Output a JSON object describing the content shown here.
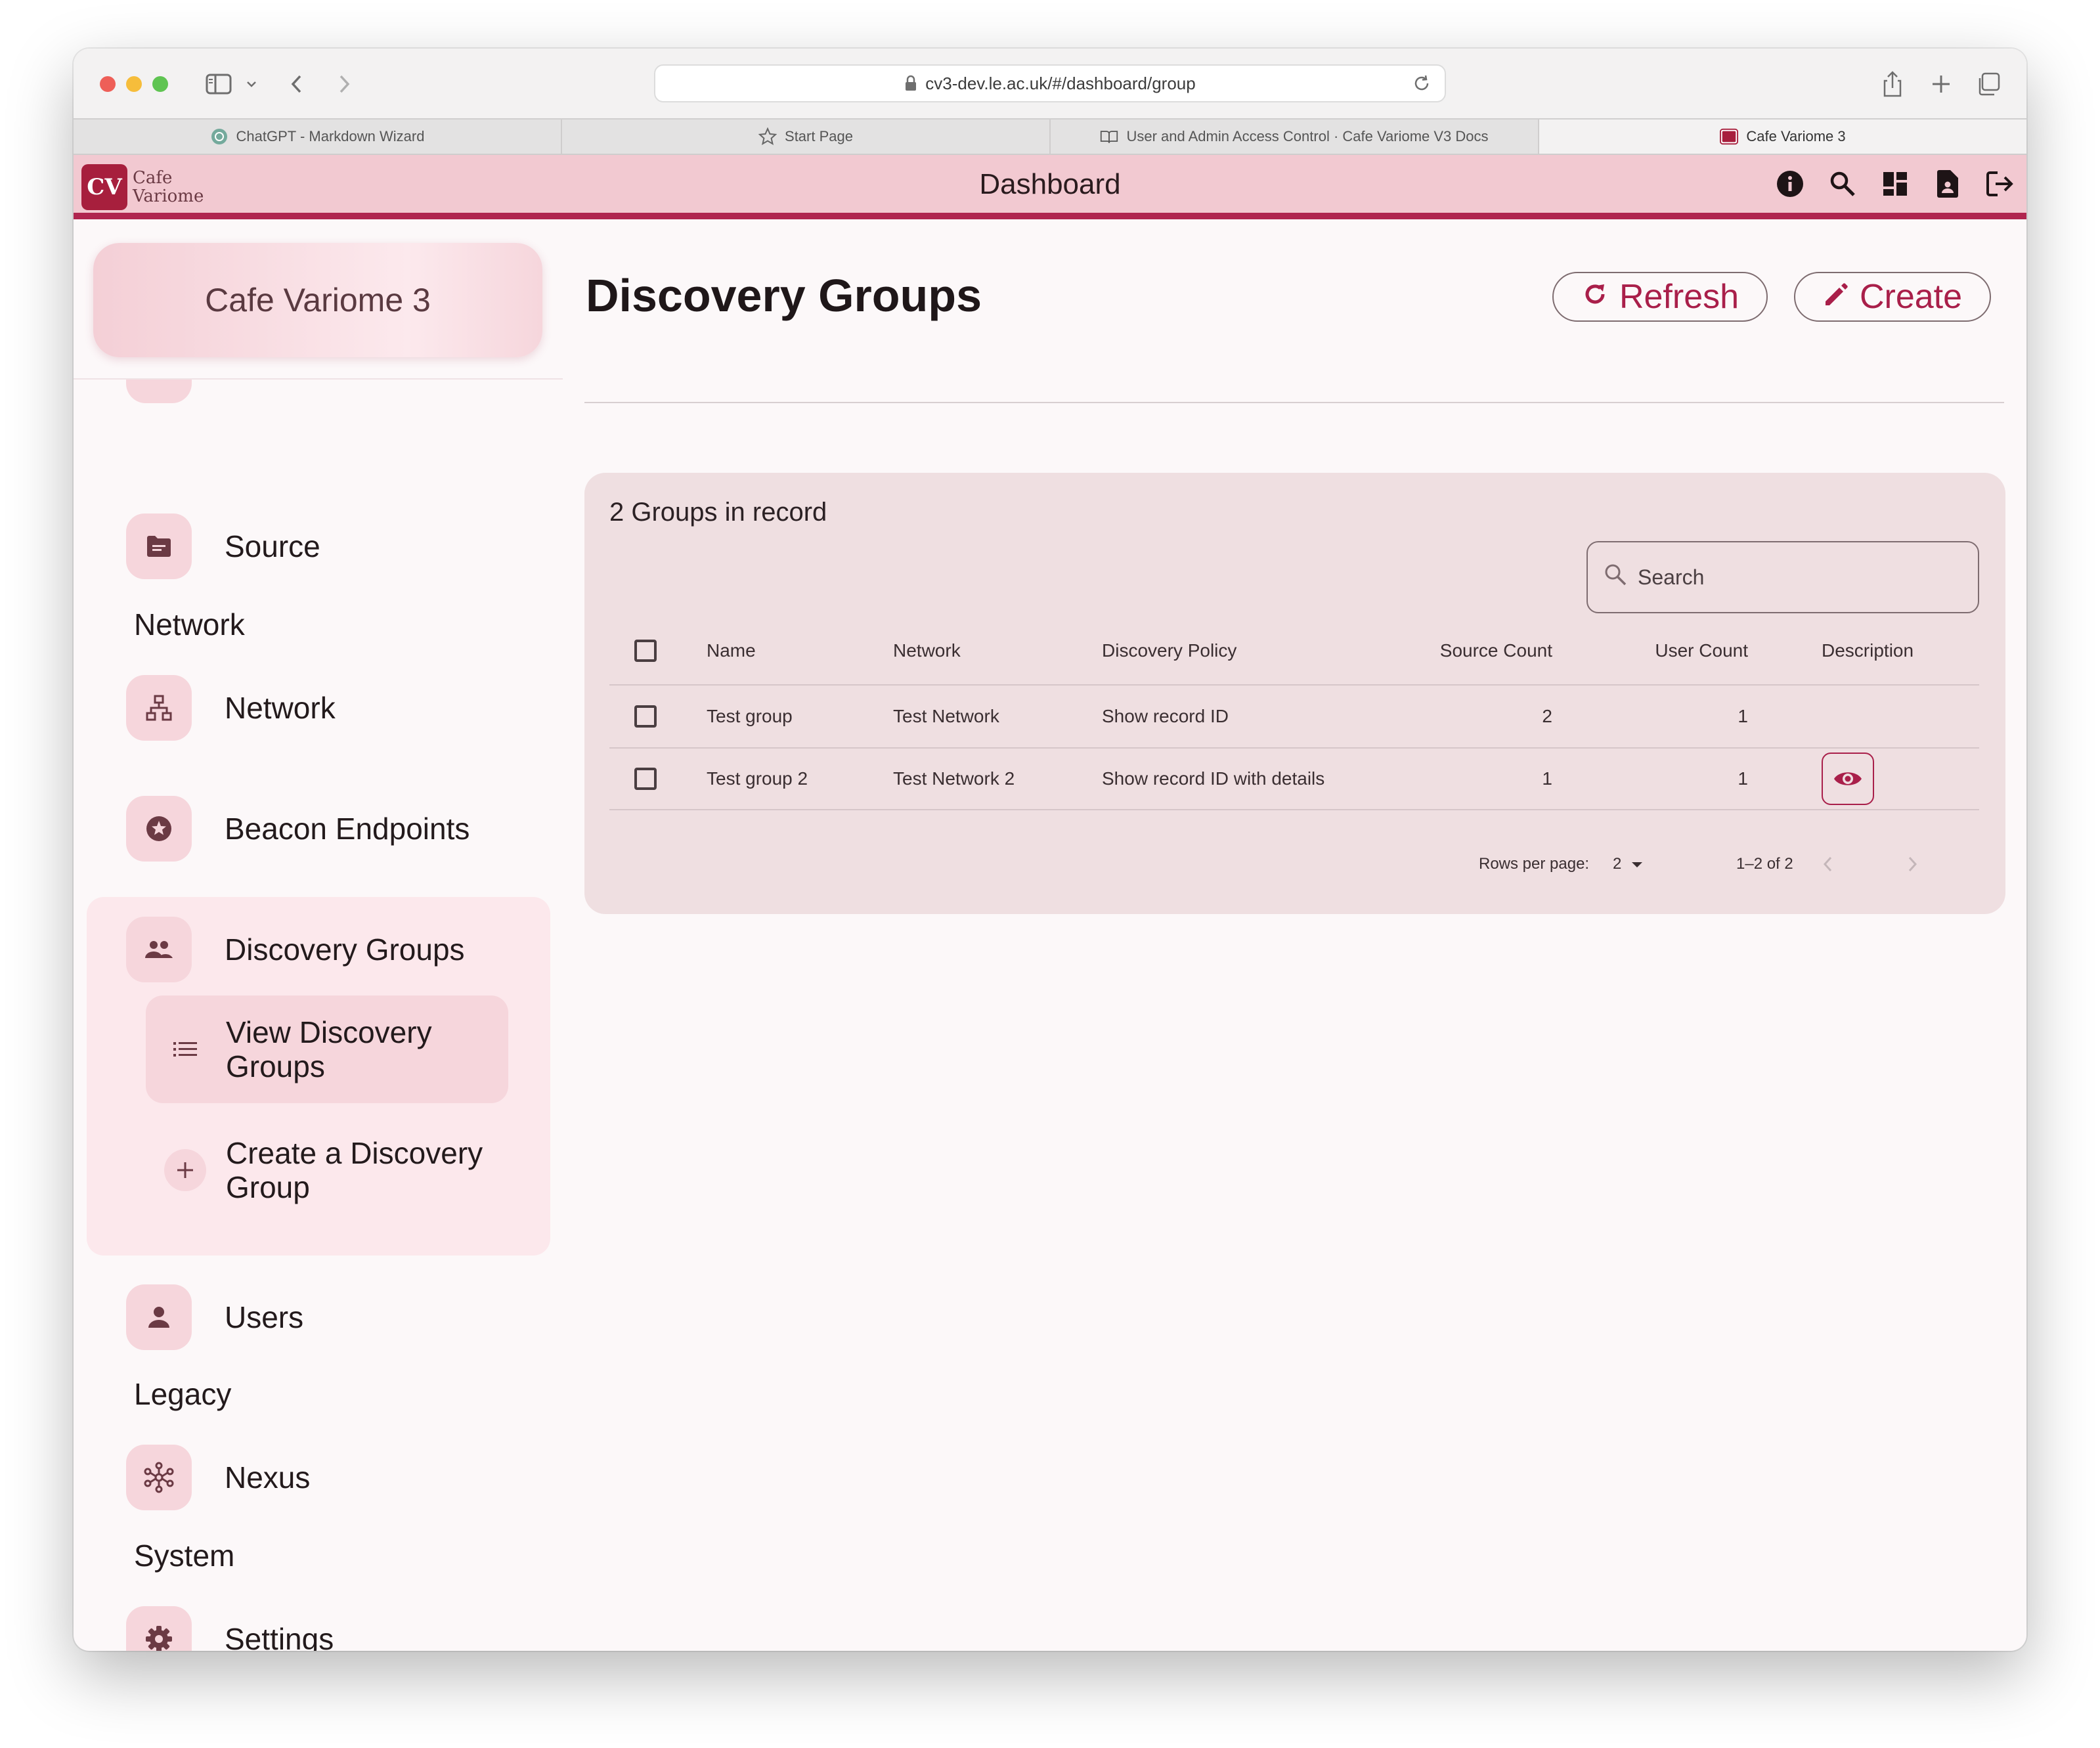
{
  "browser": {
    "url": "cv3-dev.le.ac.uk/#/dashboard/group",
    "tabs": [
      {
        "label": "ChatGPT - Markdown Wizard",
        "icon": "chatgpt-icon"
      },
      {
        "label": "Start Page",
        "icon": "star-icon"
      },
      {
        "label": "User and Admin Access Control · Cafe Variome V3 Docs",
        "icon": "book-icon"
      },
      {
        "label": "Cafe Variome 3",
        "icon": "cv-favicon",
        "active": true
      }
    ]
  },
  "appbar": {
    "logo_letters": "CV",
    "logo_line1": "Cafe",
    "logo_line2": "Variome",
    "title": "Dashboard",
    "actions": [
      "info-icon",
      "search-icon",
      "dashboard-icon",
      "document-icon",
      "logout-icon"
    ]
  },
  "sidebar": {
    "brand": "Cafe Variome 3",
    "items": {
      "source": "Source",
      "network_section": "Network",
      "network": "Network",
      "beacon": "Beacon Endpoints",
      "discovery_groups": "Discovery Groups",
      "view_groups": "View Discovery Groups",
      "create_group": "Create a Discovery Group",
      "users": "Users",
      "legacy_section": "Legacy",
      "nexus": "Nexus",
      "system_section": "System",
      "settings": "Settings"
    }
  },
  "main": {
    "title": "Discovery Groups",
    "refresh_label": "Refresh",
    "create_label": "Create",
    "record_count": "2 Groups in record",
    "search_placeholder": "Search",
    "columns": [
      "Name",
      "Network",
      "Discovery Policy",
      "Source Count",
      "User Count",
      "Description"
    ],
    "rows": [
      {
        "name": "Test group",
        "network": "Test Network",
        "policy": "Show record ID",
        "source_count": "2",
        "user_count": "1",
        "has_description": false
      },
      {
        "name": "Test group 2",
        "network": "Test Network 2",
        "policy": "Show record ID with details",
        "source_count": "1",
        "user_count": "1",
        "has_description": true
      }
    ],
    "pagination": {
      "rows_per_page_label": "Rows per page:",
      "rows_per_page": "2",
      "range": "1–2 of 2"
    }
  },
  "colors": {
    "accent": "#a91f4a",
    "appbar": "#f2c9d1",
    "appbar_border": "#b0254f",
    "card": "#efdfe1",
    "chip": "#f6d6dc"
  }
}
